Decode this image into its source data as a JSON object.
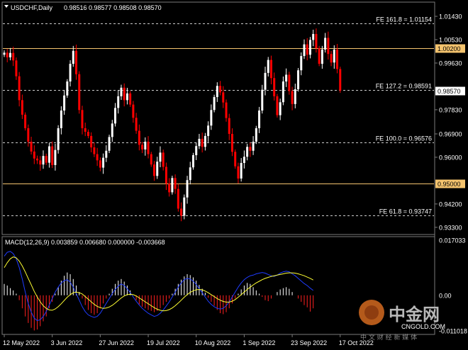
{
  "header": {
    "symbol": "USDCHF,Daily",
    "ohlc": "0.98516 0.98577 0.98508 0.98570"
  },
  "price_axis": {
    "ticks": [
      "1.01430",
      "1.00530",
      "0.99630",
      "0.98730",
      "0.97830",
      "0.96900",
      "0.96000",
      "0.95100",
      "0.94200",
      "0.93300"
    ],
    "tick_values": [
      1.0143,
      1.0053,
      0.9963,
      0.9873,
      0.9783,
      0.969,
      0.96,
      0.951,
      0.942,
      0.933
    ],
    "range": [
      0.9305,
      1.0195
    ]
  },
  "levels": [
    {
      "label": "FE 161.8 = 1.01154",
      "value": 1.01154,
      "style": "dashed",
      "color": "#cccccc"
    },
    {
      "label": "FE 127.2 = 0.98591",
      "value": 0.98591,
      "style": "dashed",
      "color": "#cccccc"
    },
    {
      "label": "FE 100.0 = 0.96576",
      "value": 0.96576,
      "style": "dashed",
      "color": "#cccccc"
    },
    {
      "label": "FE 61.8 = 0.93747",
      "value": 0.93747,
      "style": "dashed",
      "color": "#cccccc"
    },
    {
      "label": "1.00200",
      "value": 1.002,
      "style": "solid",
      "color": "#f5c46e",
      "tag": true
    },
    {
      "label": "0.95000",
      "value": 0.95,
      "style": "solid",
      "color": "#f5c46e",
      "tag": true
    }
  ],
  "current_price": {
    "label": "0.98570",
    "value": 0.9857
  },
  "macd": {
    "label": "MACD(12,26,9) 0.003859 0.006680 0.000000 -0.003668",
    "ticks": [
      "0.017033",
      "0.00",
      "-0.011018"
    ],
    "tick_values": [
      0.017033,
      0.0,
      -0.011018
    ],
    "range": [
      -0.0118,
      0.0178
    ]
  },
  "date_axis": {
    "labels": [
      "12 May 2022",
      "3 Jun 2022",
      "27 Jun 2022",
      "19 Jul 2022",
      "10 Aug 2022",
      "1 Sep 2022",
      "23 Sep 2022",
      "17 Oct 2022"
    ],
    "indices": [
      0,
      16,
      32,
      48,
      64,
      80,
      96,
      112
    ]
  },
  "watermark": {
    "brand": "中金网",
    "sub": "中 文 财 经 新 媒 体",
    "url": "CNGOLD.COM"
  },
  "colors": {
    "bull": "#ffffff",
    "bear": "#ff0000",
    "macd_line": "#1f3cff",
    "signal_line": "#ffff33",
    "level_tag": "#f5c46e",
    "grid": "#333333"
  },
  "chart_data": {
    "type": "candlestick",
    "title": "USDCHF,Daily",
    "series_open_close": [
      [
        0.9995,
        1.0003
      ],
      [
        1.0003,
        0.9985
      ],
      [
        0.9985,
        1.0002
      ],
      [
        1.0002,
        0.9973
      ],
      [
        0.9973,
        0.9912
      ],
      [
        0.9912,
        0.982
      ],
      [
        0.982,
        0.9764
      ],
      [
        0.9764,
        0.9712
      ],
      [
        0.9712,
        0.966
      ],
      [
        0.966,
        0.9622
      ],
      [
        0.9622,
        0.9595
      ],
      [
        0.9595,
        0.9588
      ],
      [
        0.9588,
        0.9572
      ],
      [
        0.9572,
        0.9605
      ],
      [
        0.9605,
        0.9579
      ],
      [
        0.9579,
        0.9642
      ],
      [
        0.9642,
        0.957
      ],
      [
        0.957,
        0.9628
      ],
      [
        0.9628,
        0.9712
      ],
      [
        0.9712,
        0.978
      ],
      [
        0.978,
        0.9838
      ],
      [
        0.9838,
        0.9892
      ],
      [
        0.9892,
        0.996
      ],
      [
        0.996,
        1.001
      ],
      [
        1.001,
        0.992
      ],
      [
        0.992,
        0.9782
      ],
      [
        0.9782,
        0.9712
      ],
      [
        0.9712,
        0.9698
      ],
      [
        0.9698,
        0.9682
      ],
      [
        0.9682,
        0.9638
      ],
      [
        0.9638,
        0.9612
      ],
      [
        0.9612,
        0.9588
      ],
      [
        0.9588,
        0.956
      ],
      [
        0.956,
        0.9598
      ],
      [
        0.9598,
        0.9625
      ],
      [
        0.9625,
        0.9678
      ],
      [
        0.9678,
        0.973
      ],
      [
        0.973,
        0.979
      ],
      [
        0.979,
        0.9835
      ],
      [
        0.9835,
        0.9868
      ],
      [
        0.9868,
        0.982
      ],
      [
        0.982,
        0.9846
      ],
      [
        0.9846,
        0.9803
      ],
      [
        0.9803,
        0.9752
      ],
      [
        0.9752,
        0.9702
      ],
      [
        0.9702,
        0.9648
      ],
      [
        0.9648,
        0.963
      ],
      [
        0.963,
        0.966
      ],
      [
        0.966,
        0.9612
      ],
      [
        0.9612,
        0.9572
      ],
      [
        0.9572,
        0.9528
      ],
      [
        0.9528,
        0.9583
      ],
      [
        0.9583,
        0.9618
      ],
      [
        0.9618,
        0.9563
      ],
      [
        0.9563,
        0.9498
      ],
      [
        0.9498,
        0.9465
      ],
      [
        0.9465,
        0.952
      ],
      [
        0.952,
        0.9478
      ],
      [
        0.9478,
        0.9402
      ],
      [
        0.9402,
        0.9375
      ],
      [
        0.9375,
        0.9445
      ],
      [
        0.9445,
        0.9512
      ],
      [
        0.9512,
        0.9561
      ],
      [
        0.9561,
        0.9608
      ],
      [
        0.9608,
        0.9643
      ],
      [
        0.9643,
        0.9671
      ],
      [
        0.9671,
        0.964
      ],
      [
        0.964,
        0.9682
      ],
      [
        0.9682,
        0.9722
      ],
      [
        0.9722,
        0.9782
      ],
      [
        0.9782,
        0.9832
      ],
      [
        0.9832,
        0.9875
      ],
      [
        0.9875,
        0.985
      ],
      [
        0.985,
        0.9811
      ],
      [
        0.9811,
        0.9751
      ],
      [
        0.9751,
        0.969
      ],
      [
        0.969,
        0.9621
      ],
      [
        0.9621,
        0.9565
      ],
      [
        0.9565,
        0.9518
      ],
      [
        0.9518,
        0.9578
      ],
      [
        0.9578,
        0.9602
      ],
      [
        0.9602,
        0.964
      ],
      [
        0.964,
        0.9625
      ],
      [
        0.9625,
        0.966
      ],
      [
        0.966,
        0.9712
      ],
      [
        0.9712,
        0.978
      ],
      [
        0.978,
        0.986
      ],
      [
        0.986,
        0.9925
      ],
      [
        0.9925,
        0.9975
      ],
      [
        0.9975,
        0.9905
      ],
      [
        0.9905,
        0.9835
      ],
      [
        0.9835,
        0.9762
      ],
      [
        0.9762,
        0.9812
      ],
      [
        0.9812,
        0.9892
      ],
      [
        0.9892,
        0.9918
      ],
      [
        0.9918,
        0.9855
      ],
      [
        0.9855,
        0.9805
      ],
      [
        0.9805,
        0.9862
      ],
      [
        0.9862,
        0.9935
      ],
      [
        0.9935,
        0.999
      ],
      [
        0.999,
        1.0035
      ],
      [
        1.0035,
        0.9995
      ],
      [
        0.9995,
        1.0052
      ],
      [
        1.0052,
        1.0075
      ],
      [
        1.0075,
        1.002
      ],
      [
        1.002,
        0.996
      ],
      [
        0.996,
        1.0015
      ],
      [
        1.0015,
        1.006
      ],
      [
        1.006,
        0.9998
      ],
      [
        0.9998,
        0.9965
      ],
      [
        0.9965,
        1.0015
      ],
      [
        1.0015,
        0.994
      ],
      [
        0.994,
        0.9857
      ]
    ],
    "y_range": [
      0.9305,
      1.0195
    ],
    "macd": {
      "histogram": [
        0.0035,
        0.003,
        0.0022,
        0.0015,
        0.0005,
        -0.0015,
        -0.004,
        -0.0065,
        -0.0085,
        -0.01,
        -0.0108,
        -0.0105,
        -0.0095,
        -0.008,
        -0.0065,
        -0.004,
        -0.002,
        0.0005,
        0.0025,
        0.0045,
        0.006,
        0.007,
        0.0065,
        0.005,
        0.003,
        0.001,
        -0.001,
        -0.003,
        -0.0045,
        -0.0055,
        -0.006,
        -0.0055,
        -0.004,
        -0.0025,
        -0.001,
        0.0005,
        0.002,
        0.0035,
        0.0045,
        0.005,
        0.0042,
        0.003,
        0.0015,
        0.0,
        -0.0015,
        -0.0028,
        -0.0035,
        -0.004,
        -0.0045,
        -0.0048,
        -0.0052,
        -0.0048,
        -0.004,
        -0.003,
        -0.002,
        -0.001,
        0.0005,
        0.002,
        0.0035,
        0.0048,
        0.0058,
        0.0065,
        0.0062,
        0.0055,
        0.0045,
        0.0032,
        0.002,
        0.0008,
        -0.0008,
        -0.002,
        -0.0032,
        -0.0045,
        -0.0055,
        -0.0058,
        -0.0052,
        -0.004,
        -0.0025,
        -0.001,
        0.0005,
        0.0018,
        0.003,
        0.0038,
        0.0035,
        0.0025,
        0.0015,
        0.0005,
        -0.0005,
        -0.0015,
        -0.0018,
        -0.001,
        0.0,
        0.001,
        0.0018,
        0.0022,
        0.0025,
        0.002,
        0.001,
        0.0,
        -0.001,
        -0.002,
        -0.003,
        -0.0037,
        -0.005,
        -0.004
      ],
      "macd_line": [
        0.012,
        0.0132,
        0.0135,
        0.0128,
        0.0112,
        0.0085,
        0.005,
        0.001,
        -0.0025,
        -0.0052,
        -0.007,
        -0.0078,
        -0.0075,
        -0.0065,
        -0.005,
        -0.003,
        -0.001,
        0.001,
        0.0025,
        0.0038,
        0.0045,
        0.0048,
        0.004,
        0.0025,
        0.0005,
        -0.0015,
        -0.0035,
        -0.005,
        -0.006,
        -0.0065,
        -0.0068,
        -0.0065,
        -0.0055,
        -0.004,
        -0.0025,
        -0.001,
        0.0005,
        0.0018,
        0.0028,
        0.0035,
        0.003,
        0.002,
        0.0008,
        -0.0005,
        -0.0018,
        -0.003,
        -0.004,
        -0.0048,
        -0.0055,
        -0.006,
        -0.0065,
        -0.0062,
        -0.0055,
        -0.0045,
        -0.0033,
        -0.002,
        -0.0005,
        0.001,
        0.0025,
        0.0038,
        0.0048,
        0.0052,
        0.005,
        0.0043,
        0.0033,
        0.002,
        0.0008,
        -0.0005,
        -0.0018,
        -0.0028,
        -0.0035,
        -0.004,
        -0.0042,
        -0.004,
        -0.0032,
        -0.002,
        -0.0005,
        0.001,
        0.0025,
        0.0038,
        0.0048,
        0.0055,
        0.006,
        0.0062,
        0.0066,
        0.0068,
        0.007,
        0.0068,
        0.0064,
        0.006,
        0.0058,
        0.0062,
        0.0068,
        0.0072,
        0.0074,
        0.0072,
        0.0066,
        0.006,
        0.0052,
        0.0044,
        0.0036,
        0.003,
        0.0022,
        0.0015
      ],
      "signal_line": [
        0.0085,
        0.01,
        0.0112,
        0.0118,
        0.0115,
        0.0105,
        0.009,
        0.0072,
        0.0052,
        0.0032,
        0.0012,
        -0.0005,
        -0.002,
        -0.0032,
        -0.004,
        -0.0045,
        -0.0046,
        -0.0042,
        -0.0035,
        -0.0026,
        -0.0016,
        -0.0006,
        0.0002,
        0.0008,
        0.001,
        0.0008,
        0.0004,
        -0.0004,
        -0.0012,
        -0.002,
        -0.0028,
        -0.0034,
        -0.0038,
        -0.004,
        -0.0039,
        -0.0036,
        -0.0031,
        -0.0024,
        -0.0016,
        -0.0008,
        -0.0002,
        0.0002,
        0.0003,
        0.0002,
        -0.0002,
        -0.0008,
        -0.0014,
        -0.002,
        -0.0026,
        -0.0032,
        -0.0038,
        -0.0043,
        -0.0046,
        -0.0048,
        -0.0047,
        -0.0044,
        -0.0039,
        -0.0032,
        -0.0024,
        -0.0015,
        -0.0006,
        0.0002,
        0.0009,
        0.0014,
        0.0017,
        0.0018,
        0.0017,
        0.0013,
        0.0008,
        0.0002,
        -0.0004,
        -0.001,
        -0.0015,
        -0.0019,
        -0.0021,
        -0.0021,
        -0.0018,
        -0.0013,
        -0.0006,
        0.0002,
        0.001,
        0.0018,
        0.0025,
        0.0032,
        0.0038,
        0.0043,
        0.0048,
        0.0052,
        0.0055,
        0.0058,
        0.006,
        0.0062,
        0.0064,
        0.0066,
        0.0068,
        0.0069,
        0.0069,
        0.0068,
        0.0066,
        0.0063,
        0.006,
        0.0056,
        0.0052,
        0.0047
      ]
    }
  }
}
